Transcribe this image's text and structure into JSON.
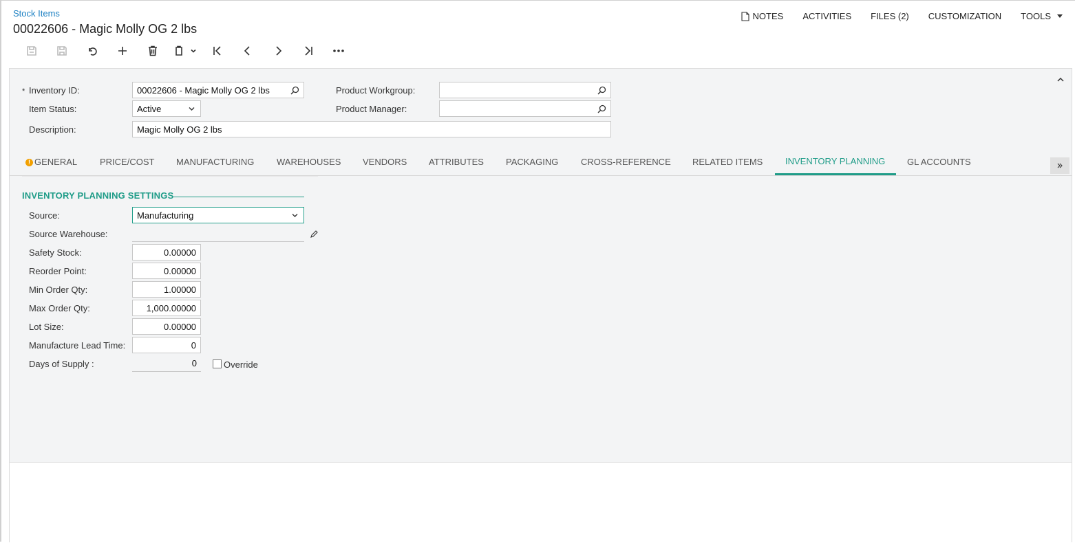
{
  "header": {
    "breadcrumb": "Stock Items",
    "title": "00022606 - Magic Molly OG 2 lbs"
  },
  "top_menu": {
    "notes": "NOTES",
    "activities": "ACTIVITIES",
    "files": "FILES (2)",
    "customization": "CUSTOMIZATION",
    "tools": "TOOLS"
  },
  "toolbar": {
    "icons": [
      "save-close-icon",
      "save-icon",
      "undo-icon",
      "add-icon",
      "delete-icon",
      "copy-paste-icon",
      "first-icon",
      "previous-icon",
      "next-icon",
      "last-icon",
      "more-icon"
    ]
  },
  "form": {
    "inventory_id_label": "Inventory ID:",
    "inventory_id_value": "00022606 - Magic Molly OG 2 lbs",
    "required_mark": "*",
    "item_status_label": "Item Status:",
    "item_status_value": "Active",
    "description_label": "Description:",
    "description_value": "Magic Molly OG 2 lbs",
    "product_workgroup_label": "Product Workgroup:",
    "product_workgroup_value": "",
    "product_manager_label": "Product Manager:",
    "product_manager_value": ""
  },
  "tabs": [
    {
      "label": "GENERAL",
      "warning": true
    },
    {
      "label": "PRICE/COST"
    },
    {
      "label": "MANUFACTURING"
    },
    {
      "label": "WAREHOUSES"
    },
    {
      "label": "VENDORS"
    },
    {
      "label": "ATTRIBUTES"
    },
    {
      "label": "PACKAGING"
    },
    {
      "label": "CROSS-REFERENCE"
    },
    {
      "label": "RELATED ITEMS"
    },
    {
      "label": "INVENTORY PLANNING",
      "active": true
    },
    {
      "label": "GL ACCOUNTS"
    }
  ],
  "planning": {
    "section_title": "INVENTORY PLANNING SETTINGS",
    "source_label": "Source:",
    "source_value": "Manufacturing",
    "source_warehouse_label": "Source Warehouse:",
    "source_warehouse_value": "",
    "safety_stock_label": "Safety Stock:",
    "safety_stock_value": "0.00000",
    "reorder_point_label": "Reorder Point:",
    "reorder_point_value": "0.00000",
    "min_order_qty_label": "Min Order Qty:",
    "min_order_qty_value": "1.00000",
    "max_order_qty_label": "Max Order Qty:",
    "max_order_qty_value": "1,000.00000",
    "lot_size_label": "Lot Size:",
    "lot_size_value": "0.00000",
    "manufacture_lead_time_label": "Manufacture Lead Time:",
    "manufacture_lead_time_value": "0",
    "days_of_supply_label": "Days of Supply :",
    "days_of_supply_value": "0",
    "override_label": "Override",
    "override_checked": false
  },
  "colors": {
    "accent": "#1f9c88",
    "link": "#1a7fc2",
    "warning": "#f2a000",
    "panel_bg": "#f3f4f5"
  }
}
